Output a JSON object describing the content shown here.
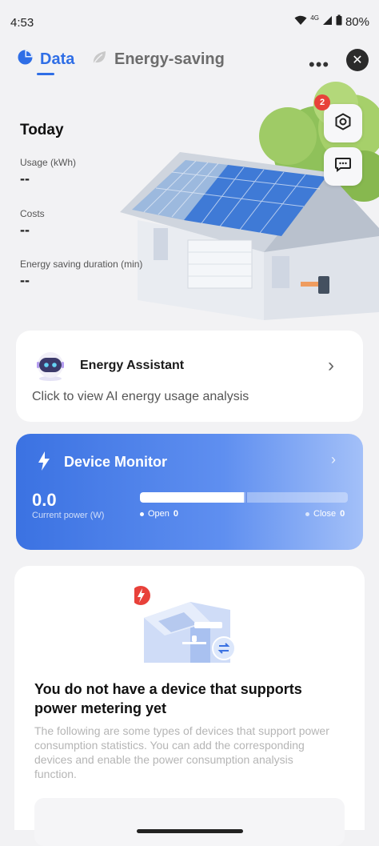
{
  "status_bar": {
    "time": "4:53",
    "network": "4G",
    "battery": "80%"
  },
  "tabs": [
    {
      "label": "Data",
      "active": true
    },
    {
      "label": "Energy-saving",
      "active": false
    }
  ],
  "header": {
    "more_label": "•••"
  },
  "hero": {
    "title": "Today",
    "stats": [
      {
        "label": "Usage (kWh)",
        "value": "--"
      },
      {
        "label": "Costs",
        "value": "--"
      },
      {
        "label": "Energy saving duration (min)",
        "value": "--"
      }
    ],
    "notification_count": "2"
  },
  "assistant": {
    "title": "Energy Assistant",
    "description": "Click to view AI energy usage analysis"
  },
  "monitor": {
    "title": "Device Monitor",
    "power_value": "0.0",
    "power_label": "Current power (W)",
    "open_label": "Open",
    "open_count": "0",
    "close_label": "Close",
    "close_count": "0",
    "open_fraction": 0.5
  },
  "empty_state": {
    "headline": "You do not have a device that supports power metering yet",
    "body": "The following are some types of devices that support power consumption statistics. You can add the corresponding devices and enable the power consumption analysis function."
  },
  "colors": {
    "accent": "#2f6ee6",
    "badge": "#e8413a"
  }
}
